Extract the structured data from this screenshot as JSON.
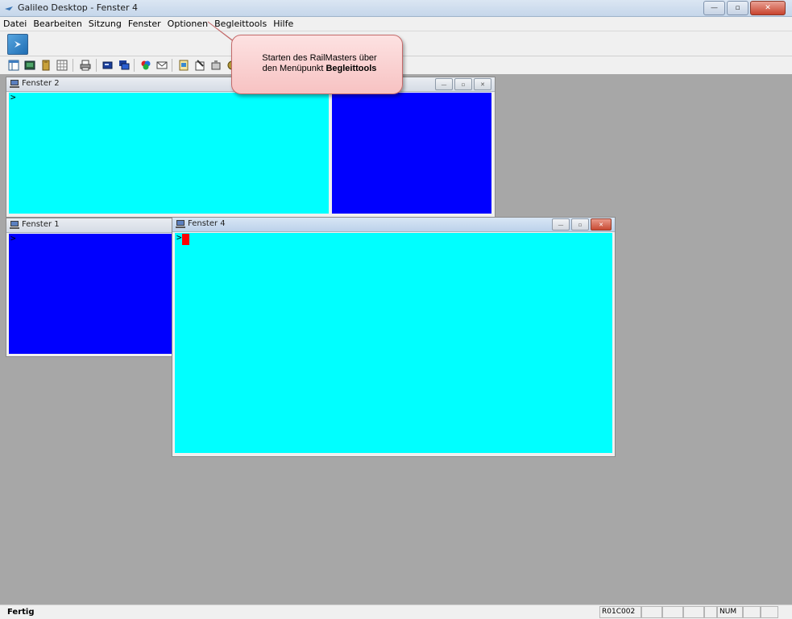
{
  "app": {
    "title": "Galileo Desktop - Fenster 4"
  },
  "menu": [
    "Datei",
    "Bearbeiten",
    "Sitzung",
    "Fenster",
    "Optionen",
    "Begleittools",
    "Hilfe"
  ],
  "callout": {
    "line1": "Starten des RailMasters über",
    "line2_prefix": "den Menüpunkt ",
    "line2_bold": "Begleittools"
  },
  "windows": {
    "fenster2": {
      "title": "Fenster 2",
      "prompt": ">"
    },
    "fenster1": {
      "title": "Fenster 1",
      "prompt": ">"
    },
    "fenster4": {
      "title": "Fenster 4",
      "prompt": ">"
    }
  },
  "colors": {
    "cyan": "#00ffff",
    "blue": "#0000ff",
    "cursor": "#ff0000",
    "desktop": "#a7a7a7"
  },
  "status": {
    "text": "Fertig",
    "cursor_pos": "R01C002",
    "num": "NUM"
  }
}
